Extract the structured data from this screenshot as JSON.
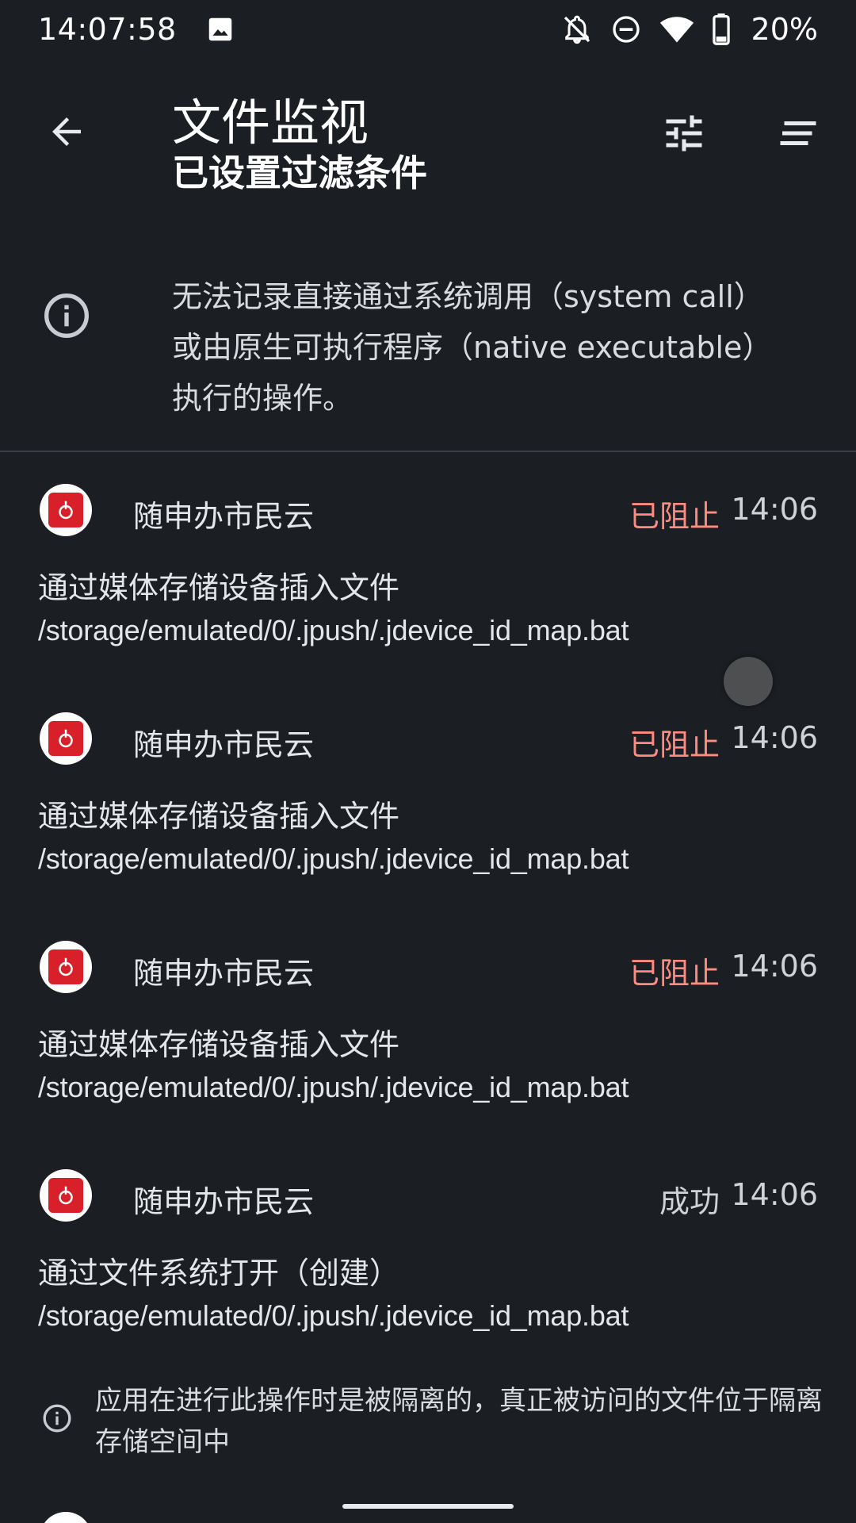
{
  "status_bar": {
    "time": "14:07:58",
    "left_icon": "image-icon",
    "icons": [
      "bell-off-icon",
      "do-not-disturb-icon",
      "wifi-icon",
      "battery-icon"
    ],
    "battery": "20%"
  },
  "app_bar": {
    "title": "文件监视",
    "subtitle": "已设置过滤条件",
    "back_icon": "arrow-back-icon",
    "filter_icon": "tune-icon",
    "sort_icon": "sort-icon"
  },
  "notice": {
    "icon": "info-icon",
    "text": "无法记录直接通过系统调用（system call）或由原生可执行程序（native executable）执行的操作。"
  },
  "entries": [
    {
      "app": "随申办市民云",
      "status": "已阻止",
      "status_type": "blocked",
      "time": "14:06",
      "operation": "通过媒体存储设备插入文件",
      "path": "/storage/emulated/0/.jpush/.jdevice_id_map.bat"
    },
    {
      "app": "随申办市民云",
      "status": "已阻止",
      "status_type": "blocked",
      "time": "14:06",
      "operation": "通过媒体存储设备插入文件",
      "path": "/storage/emulated/0/.jpush/.jdevice_id_map.bat"
    },
    {
      "app": "随申办市民云",
      "status": "已阻止",
      "status_type": "blocked",
      "time": "14:06",
      "operation": "通过媒体存储设备插入文件",
      "path": "/storage/emulated/0/.jpush/.jdevice_id_map.bat"
    },
    {
      "app": "随申办市民云",
      "status": "成功",
      "status_type": "success",
      "time": "14:06",
      "operation": "通过文件系统打开（创建）",
      "path": "/storage/emulated/0/.jpush/.jdevice_id_map.bat",
      "note": "应用在进行此操作时是被隔离的，真正被访问的文件位于隔离存储空间中"
    }
  ],
  "colors": {
    "background": "#1b1e22",
    "blocked": "#ff8a80",
    "app_icon_red": "#d8202b"
  }
}
